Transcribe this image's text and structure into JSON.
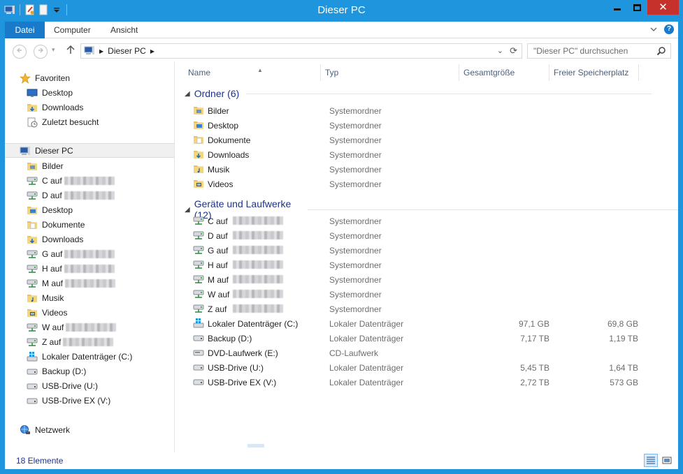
{
  "window": {
    "title": "Dieser PC",
    "qat_icons": [
      "computer-icon",
      "properties-icon",
      "new-folder-icon",
      "customize-qat-icon"
    ]
  },
  "ribbon": {
    "tabs": [
      "Datei",
      "Computer",
      "Ansicht"
    ]
  },
  "address": {
    "crumb": "Dieser PC",
    "search_placeholder": "\"Dieser PC\" durchsuchen"
  },
  "nav": {
    "favorites": {
      "label": "Favoriten",
      "items": [
        "Desktop",
        "Downloads",
        "Zuletzt besucht"
      ]
    },
    "this_pc": {
      "label": "Dieser PC",
      "items": [
        {
          "label": "Bilder",
          "icon": "pictures-folder-icon"
        },
        {
          "label": "C auf",
          "icon": "network-drive-icon",
          "redacted": true
        },
        {
          "label": "D auf",
          "icon": "network-drive-icon",
          "redacted": true
        },
        {
          "label": "Desktop",
          "icon": "desktop-folder-icon"
        },
        {
          "label": "Dokumente",
          "icon": "documents-folder-icon"
        },
        {
          "label": "Downloads",
          "icon": "downloads-folder-icon"
        },
        {
          "label": "G auf",
          "icon": "network-drive-icon",
          "redacted": true
        },
        {
          "label": "H auf",
          "icon": "network-drive-icon",
          "redacted": true
        },
        {
          "label": "M auf",
          "icon": "network-drive-icon",
          "redacted": true
        },
        {
          "label": "Musik",
          "icon": "music-folder-icon"
        },
        {
          "label": "Videos",
          "icon": "videos-folder-icon"
        },
        {
          "label": "W auf",
          "icon": "network-drive-icon",
          "redacted": true
        },
        {
          "label": "Z auf",
          "icon": "network-drive-icon",
          "redacted": true
        },
        {
          "label": "Lokaler Datenträger (C:)",
          "icon": "system-drive-icon"
        },
        {
          "label": "Backup (D:)",
          "icon": "drive-icon"
        },
        {
          "label": "USB-Drive (U:)",
          "icon": "drive-icon"
        },
        {
          "label": "USB-Drive EX (V:)",
          "icon": "drive-icon"
        }
      ]
    },
    "network": {
      "label": "Netzwerk"
    }
  },
  "columns": [
    "Name",
    "Typ",
    "Gesamtgröße",
    "Freier Speicherplatz"
  ],
  "groups": [
    {
      "title": "Ordner (6)",
      "rows": [
        {
          "name": "Bilder",
          "type": "Systemordner",
          "total": "",
          "free": "",
          "icon": "pictures-folder-icon"
        },
        {
          "name": "Desktop",
          "type": "Systemordner",
          "total": "",
          "free": "",
          "icon": "desktop-folder-icon"
        },
        {
          "name": "Dokumente",
          "type": "Systemordner",
          "total": "",
          "free": "",
          "icon": "documents-folder-icon"
        },
        {
          "name": "Downloads",
          "type": "Systemordner",
          "total": "",
          "free": "",
          "icon": "downloads-folder-icon"
        },
        {
          "name": "Musik",
          "type": "Systemordner",
          "total": "",
          "free": "",
          "icon": "music-folder-icon"
        },
        {
          "name": "Videos",
          "type": "Systemordner",
          "total": "",
          "free": "",
          "icon": "videos-folder-icon"
        }
      ]
    },
    {
      "title": "Geräte und Laufwerke (12)",
      "rows": [
        {
          "name": "C auf",
          "type": "Systemordner",
          "total": "",
          "free": "",
          "icon": "network-drive-icon",
          "redacted": true
        },
        {
          "name": "D auf",
          "type": "Systemordner",
          "total": "",
          "free": "",
          "icon": "network-drive-icon",
          "redacted": true
        },
        {
          "name": "G auf",
          "type": "Systemordner",
          "total": "",
          "free": "",
          "icon": "network-drive-icon",
          "redacted": true
        },
        {
          "name": "H auf",
          "type": "Systemordner",
          "total": "",
          "free": "",
          "icon": "network-drive-icon",
          "redacted": true
        },
        {
          "name": "M auf",
          "type": "Systemordner",
          "total": "",
          "free": "",
          "icon": "network-drive-icon",
          "redacted": true
        },
        {
          "name": "W auf",
          "type": "Systemordner",
          "total": "",
          "free": "",
          "icon": "network-drive-icon",
          "redacted": true
        },
        {
          "name": "Z auf",
          "type": "Systemordner",
          "total": "",
          "free": "",
          "icon": "network-drive-icon",
          "redacted": true
        },
        {
          "name": "Lokaler Datenträger (C:)",
          "type": "Lokaler Datenträger",
          "total": "97,1 GB",
          "free": "69,8 GB",
          "icon": "system-drive-icon"
        },
        {
          "name": "Backup (D:)",
          "type": "Lokaler Datenträger",
          "total": "7,17 TB",
          "free": "1,19 TB",
          "icon": "drive-icon"
        },
        {
          "name": "DVD-Laufwerk (E:)",
          "type": "CD-Laufwerk",
          "total": "",
          "free": "",
          "icon": "dvd-drive-icon"
        },
        {
          "name": "USB-Drive (U:)",
          "type": "Lokaler Datenträger",
          "total": "5,45 TB",
          "free": "1,64 TB",
          "icon": "drive-icon"
        },
        {
          "name": "USB-Drive EX (V:)",
          "type": "Lokaler Datenträger",
          "total": "2,72 TB",
          "free": "573 GB",
          "icon": "drive-icon"
        }
      ]
    }
  ],
  "status": {
    "count": "18 Elemente"
  },
  "colors": {
    "titlebar": "#1e95dc",
    "file_tab": "#1979ca",
    "close": "#c7312b",
    "group_header": "#1e3287"
  }
}
